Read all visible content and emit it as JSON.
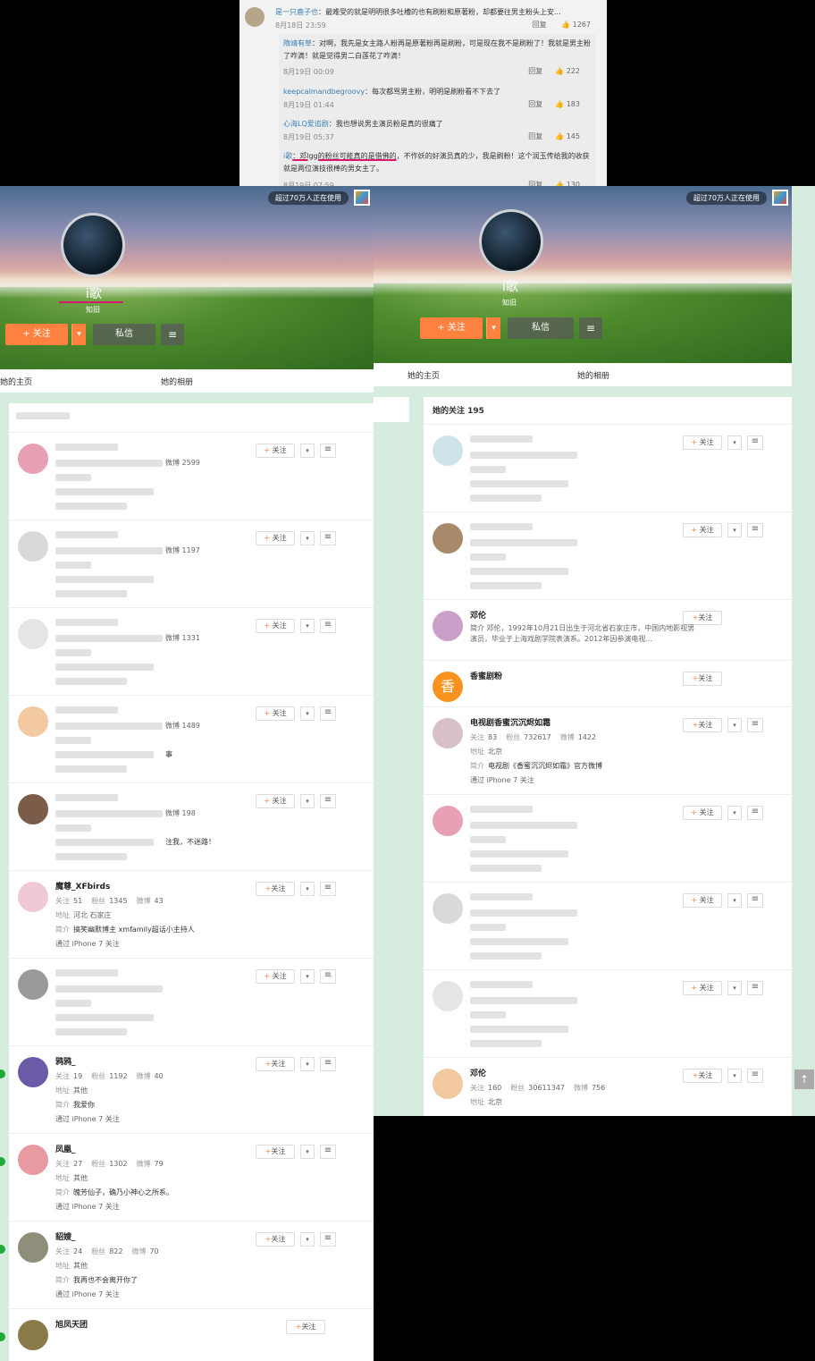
{
  "comments": {
    "main": {
      "user": "是一只鹿子也",
      "text": "：最难受的就是明明很多吐槽的也有刷粉和原著粉，却都要往男主粉头上安...",
      "time": "8月18日 23:59",
      "reply": "回复",
      "likes": "1267"
    },
    "replies": [
      {
        "user": "隋靖有草",
        "text": "：对啊，我先是女主路人粉再是原著粉再是刷粉，可是现在我不是刷粉了！我就是男主粉了咋滴！就是觉得男二白莲花了咋滴！",
        "time": "8月19日 00:09",
        "reply": "回复",
        "likes": "222"
      },
      {
        "user": "keepcalmandbegroovy",
        "text": "：每次都骂男主粉，明明是刷粉看不下去了",
        "time": "8月19日 01:44",
        "reply": "回复",
        "likes": "183"
      },
      {
        "user": "心海LQ爱追剧",
        "text": "：我也想说男主演员粉是真的很痛了",
        "time": "8月19日 05:37",
        "reply": "回复",
        "likes": "145"
      },
      {
        "user": "i歌",
        "text_hl": "：邓lgg的粉丝可能真的是借佛的",
        "text": "，不作妖的好演员真的少，我是刷粉！这个润玉传给我的收获就是两位演技很棒的男女主了。",
        "time": "8月19日 07:59",
        "reply": "回复",
        "likes": "130"
      }
    ]
  },
  "left": {
    "badge": "超过70万人正在使用",
    "name": "i歌",
    "subtitle": "知旧",
    "follow": "+ 关注",
    "drop": "▾",
    "msg": "私信",
    "menu": "≡",
    "tabs": [
      "她的主页",
      "她的相册"
    ],
    "rows": [
      {
        "weibo": "微博 2599",
        "named": false
      },
      {
        "weibo": "微博 1197",
        "named": false
      },
      {
        "weibo": "微博 1331",
        "named": false
      },
      {
        "weibo": "微博 1489",
        "extra": "事",
        "named": false
      },
      {
        "weibo": "微博 198",
        "extra": "注我，不迷路！",
        "named": false
      },
      {
        "named": true,
        "name": "魔尊_XFbirds",
        "follow": "关注",
        "f": "51",
        "fans": "1345",
        "wb": "43",
        "addr": "河北 石家庄",
        "desc": "搞笑幽默博主 xmfamily超话小主持人",
        "via": "通过 iPhone 7 关注"
      },
      {
        "weibo": "",
        "named": false
      },
      {
        "named": true,
        "online": true,
        "name": "鸦鸦_",
        "follow": "关注",
        "f": "19",
        "fans": "1192",
        "wb": "40",
        "addr": "其他",
        "desc": "我爱你",
        "via": "通过 iPhone 7 关注"
      },
      {
        "named": true,
        "online": true,
        "name": "凤凰_",
        "follow": "关注",
        "f": "27",
        "fans": "1302",
        "wb": "79",
        "addr": "其他",
        "desc": "魄芳仙子，确乃小神心之所系。",
        "via": "通过 iPhone 7 关注"
      },
      {
        "named": true,
        "online": true,
        "name": "貂嫂_",
        "follow": "关注",
        "f": "24",
        "fans": "822",
        "wb": "70",
        "addr": "其他",
        "desc": "我再也不会离开你了",
        "via": "通过 iPhone 7 关注"
      },
      {
        "named": true,
        "online": true,
        "name": "旭凤天团",
        "follow": "关注",
        "short": true
      }
    ]
  },
  "right": {
    "badge": "超过70万人正在使用",
    "name": "i歌",
    "subtitle": "知旧",
    "follow": "+ 关注",
    "drop": "▾",
    "msg": "私信",
    "menu": "≡",
    "tabs": [
      "她的主页",
      "她的相册"
    ],
    "list_title": "她的关注 195",
    "rows": [
      {
        "named": false
      },
      {
        "named": false
      },
      {
        "named": true,
        "name": "邓伦",
        "bio": "简介 邓伦，1992年10月21日出生于河北省石家庄市，中国内地影视男演员，毕业于上海戏剧学院表演系。2012年因参演电视...",
        "follow": "关注",
        "simple": true
      },
      {
        "named": true,
        "name": "香蜜剧粉",
        "follow": "关注",
        "simple2": true,
        "avatar_char": "香"
      },
      {
        "named": true,
        "name": "电视剧香蜜沉沉烬如霜",
        "follow": "关注",
        "f": "83",
        "fans": "732617",
        "wb": "1422",
        "addr": "北京",
        "desc": "电视剧《香蜜沉沉烬如霜》官方微博",
        "via": "通过 iPhone 7 关注"
      },
      {
        "named": false
      },
      {
        "named": false
      },
      {
        "named": false
      },
      {
        "named": true,
        "name": "邓伦",
        "follow": "关注",
        "f": "160",
        "fans": "30611347",
        "wb": "756",
        "addr": "北京",
        "partial": true
      }
    ]
  },
  "labels": {
    "follow_k": "关注",
    "fans_k": "粉丝",
    "wb_k": "微博",
    "addr_k": "地址",
    "desc_k": "简介",
    "plus": "+"
  }
}
